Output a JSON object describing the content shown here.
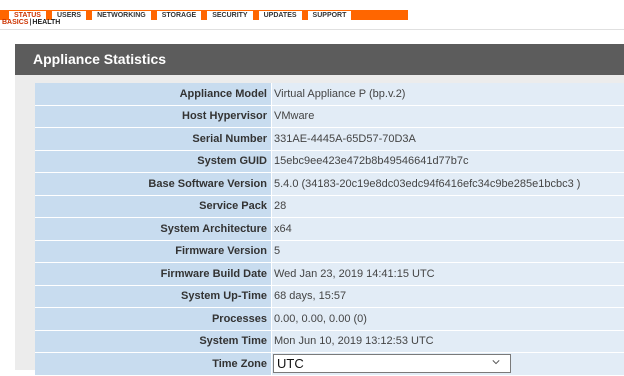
{
  "nav": {
    "tabs": [
      "STATUS",
      "USERS",
      "NETWORKING",
      "STORAGE",
      "SECURITY",
      "UPDATES",
      "SUPPORT"
    ],
    "active_tab": "STATUS",
    "subtabs": [
      "BASICS",
      "HEALTH"
    ],
    "active_subtab": "BASICS"
  },
  "panel": {
    "title": "Appliance Statistics",
    "rows": [
      {
        "label": "Appliance Model",
        "value": "Virtual Appliance P (bp.v.2)"
      },
      {
        "label": "Host Hypervisor",
        "value": "VMware"
      },
      {
        "label": "Serial Number",
        "value": "331AE-4445A-65D57-70D3A"
      },
      {
        "label": "System GUID",
        "value": "15ebc9ee423e472b8b49546641d77b7c"
      },
      {
        "label": "Base Software Version",
        "value": "5.4.0 (34183-20c19e8dc03edc94f6416efc34c9be285e1bcbc3 )"
      },
      {
        "label": "Service Pack",
        "value": "28"
      },
      {
        "label": "System Architecture",
        "value": "x64"
      },
      {
        "label": "Firmware Version",
        "value": "5"
      },
      {
        "label": "Firmware Build Date",
        "value": "Wed Jan 23, 2019 14:41:15 UTC"
      },
      {
        "label": "System Up-Time",
        "value": "68 days, 15:57"
      },
      {
        "label": "Processes",
        "value": "0.00, 0.00, 0.00 (0)"
      },
      {
        "label": "System Time",
        "value": "Mon Jun 10, 2019 13:12:53 UTC"
      }
    ],
    "timezone": {
      "label": "Time Zone",
      "selected": "UTC"
    }
  },
  "colors": {
    "accent": "#ff6600",
    "header_bg": "#5c5c5c",
    "label_bg": "#c8dcef",
    "value_bg": "#e2ecf6"
  },
  "icons": {
    "select_arrow": "chevron-down-icon"
  }
}
